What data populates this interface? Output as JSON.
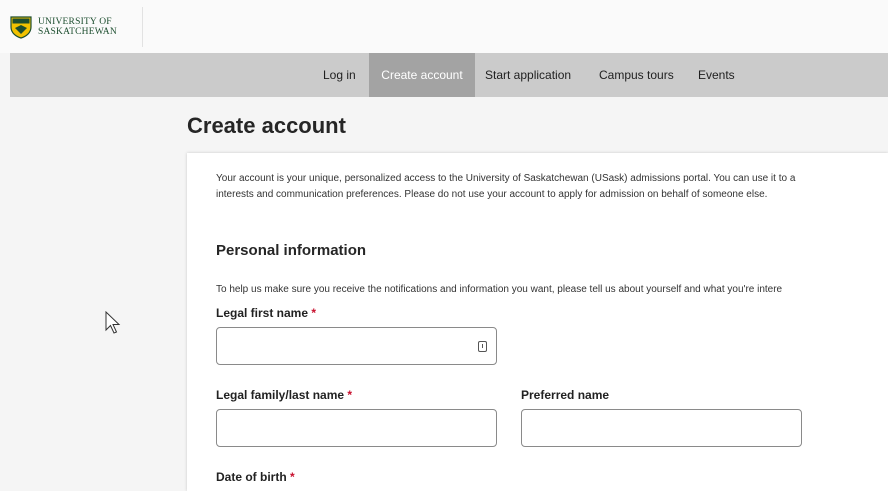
{
  "header": {
    "logo_line1": "UNIVERSITY OF",
    "logo_line2": "SASKATCHEWAN"
  },
  "nav": {
    "items": [
      {
        "label": "Log in",
        "active": false
      },
      {
        "label": "Create account",
        "active": true
      },
      {
        "label": "Start application",
        "active": false
      },
      {
        "label": "Campus tours",
        "active": false
      },
      {
        "label": "Events",
        "active": false
      }
    ]
  },
  "page": {
    "title": "Create account",
    "intro_line1": "Your account is your unique, personalized access to the University of Saskatchewan (USask) admissions portal. You can use it to a",
    "intro_line2": "interests and communication preferences. Please do not use your account to apply for admission on behalf of someone else."
  },
  "personal": {
    "title": "Personal information",
    "description": "To help us make sure you receive the notifications and information you want, please tell us about yourself and what you're intere",
    "fields": {
      "first_name": {
        "label": "Legal first name",
        "required_mark": "*",
        "value": ""
      },
      "last_name": {
        "label": "Legal family/last name",
        "required_mark": "*",
        "value": ""
      },
      "preferred_name": {
        "label": "Preferred name",
        "value": ""
      },
      "dob": {
        "label": "Date of birth",
        "required_mark": "*"
      }
    }
  },
  "colors": {
    "nav_bg": "#cbcbcb",
    "nav_active_bg": "#a3a3a3",
    "required": "#c8102e",
    "brand_green": "#1d4e2f",
    "brand_gold": "#f2c200"
  },
  "icons": {
    "logo": "usask-shield-icon",
    "autofill": "autofill-icon",
    "cursor": "mouse-pointer-icon"
  }
}
